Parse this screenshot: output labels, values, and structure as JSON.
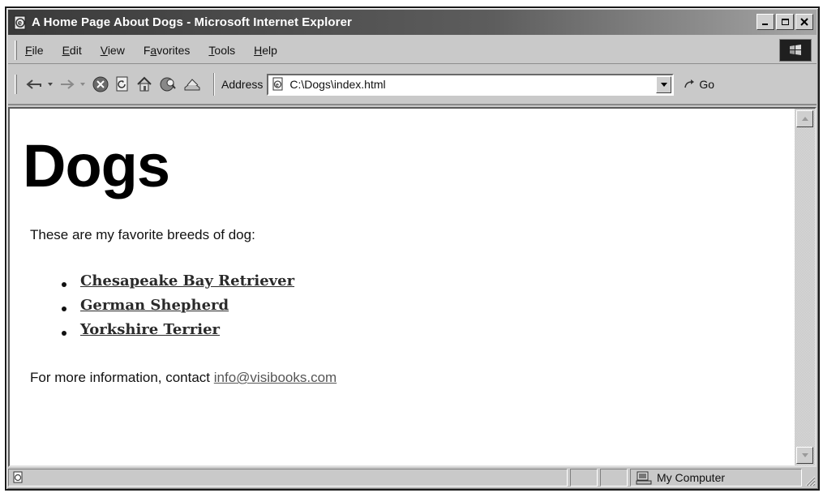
{
  "window": {
    "title": "A Home Page About Dogs - Microsoft Internet Explorer"
  },
  "menu": {
    "items": [
      {
        "label": "File",
        "accel": "F",
        "rest": "ile"
      },
      {
        "label": "Edit",
        "accel": "E",
        "rest": "dit"
      },
      {
        "label": "View",
        "accel": "V",
        "rest": "iew"
      },
      {
        "label": "Favorites",
        "accel": "a",
        "pre": "F",
        "rest": "vorites"
      },
      {
        "label": "Tools",
        "accel": "T",
        "rest": "ools"
      },
      {
        "label": "Help",
        "accel": "H",
        "rest": "elp"
      }
    ]
  },
  "toolbar": {
    "address_label": "Address",
    "address_value": "C:\\Dogs\\index.html",
    "go_label": "Go"
  },
  "page": {
    "heading": "Dogs",
    "intro": "These are my favorite breeds of dog:",
    "breeds": [
      "Chesapeake Bay Retriever",
      "German Shepherd",
      "Yorkshire Terrier"
    ],
    "contact_text": "For more information, contact ",
    "contact_email": "info@visibooks.com"
  },
  "status": {
    "zone": "My Computer"
  }
}
